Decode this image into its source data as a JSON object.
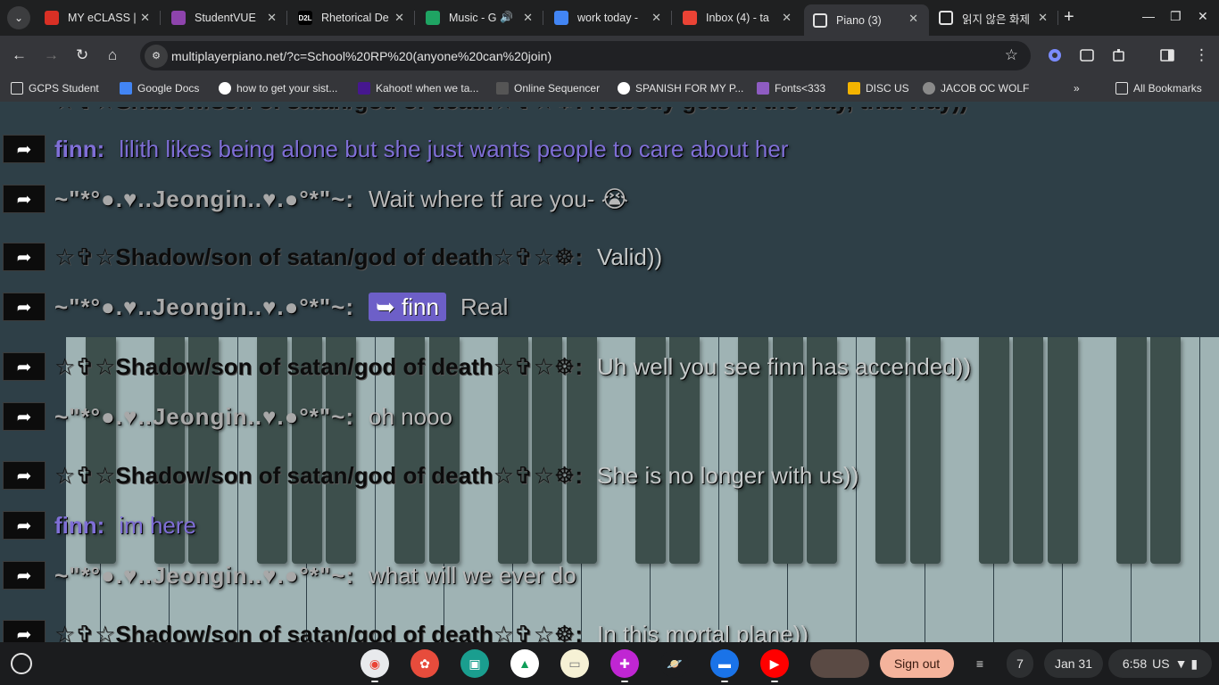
{
  "tabs": [
    {
      "title": "MY eCLASS |",
      "favicon": "eclass-icon",
      "color": "#d93025"
    },
    {
      "title": "StudentVUE",
      "favicon": "studentvue-icon",
      "color": "#8e44ad"
    },
    {
      "title": "Rhetorical De",
      "favicon": "d2l-icon",
      "color": "#ffffff"
    },
    {
      "title": "Music - G",
      "favicon": "drive-icon",
      "color": "#1fa463"
    },
    {
      "title": "work today -",
      "favicon": "docs-icon",
      "color": "#4285f4"
    },
    {
      "title": "Inbox (4) - ta",
      "favicon": "gmail-icon",
      "color": "#ea4335"
    },
    {
      "title": "Piano (3)",
      "favicon": "piano-icon",
      "color": "#e3e3e3"
    },
    {
      "title": "읽지 않은 화제",
      "favicon": "doc-icon",
      "color": "#e3e3e3"
    }
  ],
  "d2l_label": "D2L",
  "url": "multiplayerpiano.net/?c=School%20RP%20(anyone%20can%20join)",
  "bookmarks": [
    {
      "label": "GCPS Student",
      "icon": "folder-icon"
    },
    {
      "label": "Google Docs",
      "icon": "docs-icon"
    },
    {
      "label": "how to get your sist...",
      "icon": "google-icon"
    },
    {
      "label": "Kahoot! when we ta...",
      "icon": "kahoot-icon"
    },
    {
      "label": "Online Sequencer",
      "icon": "sequencer-icon"
    },
    {
      "label": "SPANISH FOR MY P...",
      "icon": "google-icon"
    },
    {
      "label": "Fonts<333",
      "icon": "fonts-icon"
    },
    {
      "label": "DISC US",
      "icon": "crown-icon"
    },
    {
      "label": "JACOB OC WOLF",
      "icon": "globe-icon"
    }
  ],
  "all_bookmarks_label": "All Bookmarks",
  "chat": {
    "top_partial": "☆✞☆Shadow/son of satan/god of death☆✞☆☸: Nobody gets in the way, that way))",
    "messages": [
      {
        "nick": "finn:",
        "role": "finn",
        "text": "lilith likes being alone but she just wants people to care about her"
      },
      {
        "nick": "~\"*°●.♥..Jeongin..♥.●°*\"~:",
        "role": "jeong",
        "text": "Wait where tf are you- 😭"
      },
      {
        "nick": "☆✞☆Shadow/son of satan/god of death☆✞☆☸:",
        "role": "shadow",
        "text": "Valid))"
      },
      {
        "nick": "~\"*°●.♥..Jeongin..♥.●°*\"~:",
        "role": "jeong",
        "mention": "➥ finn",
        "text": "Real"
      },
      {
        "nick": "☆✞☆Shadow/son of satan/god of death☆✞☆☸:",
        "role": "shadow",
        "text": "Uh well you see finn has accended))"
      },
      {
        "nick": "~\"*°●.♥..Jeongin..♥.●°*\"~:",
        "role": "jeong",
        "text": "oh nooo"
      },
      {
        "nick": "☆✞☆Shadow/son of satan/god of death☆✞☆☸:",
        "role": "shadow",
        "text": "She is no longer with us))"
      },
      {
        "nick": "finn:",
        "role": "finn",
        "text": "im here"
      },
      {
        "nick": "~\"*°●.♥..Jeongin..♥.●°*\"~:",
        "role": "jeong",
        "text": "what will we ever do"
      },
      {
        "nick": "☆✞☆Shadow/son of satan/god of death☆✞☆☸:",
        "role": "shadow",
        "text": "In this mortal plane))"
      }
    ]
  },
  "shelf": {
    "apps": [
      "chrome-icon",
      "canvas-icon",
      "classroom-icon",
      "drive-icon",
      "keep-icon",
      "screencast-icon",
      "saturn-icon",
      "files-icon",
      "youtube-icon"
    ],
    "sign_out": "Sign out",
    "notification_count": "7",
    "date": "Jan 31",
    "time": "6:58",
    "locale": "US"
  }
}
